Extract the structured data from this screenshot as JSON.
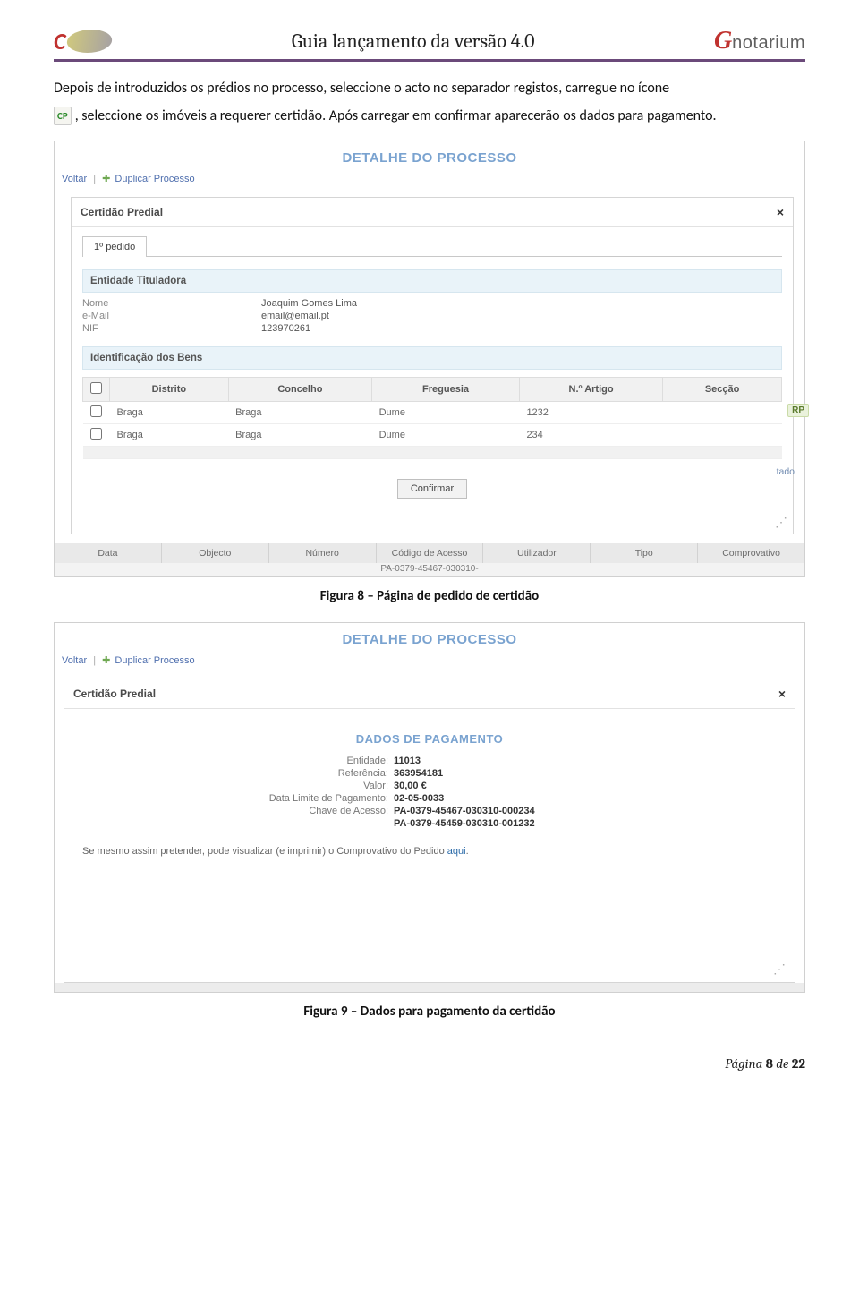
{
  "header": {
    "title": "Guia lançamento da versão 4.0",
    "brand_right_g": "G",
    "brand_right_rest": "notarium"
  },
  "paragraph": {
    "line1_a": "Depois de introduzidos os prédios no processo, seleccione o acto no separador registos, carregue no ícone",
    "cp_icon": "CP",
    "line2": ", seleccione os imóveis a requerer certidão. Após carregar em confirmar aparecerão os dados para pagamento."
  },
  "shot1": {
    "title": "DETALHE DO PROCESSO",
    "toolbar_back": "Voltar",
    "toolbar_dup": "Duplicar Processo",
    "panel_title": "Certidão Predial",
    "tab1": "1º pedido",
    "section1": "Entidade Tituladora",
    "fields": {
      "nome_l": "Nome",
      "nome_v": "Joaquim Gomes Lima",
      "email_l": "e-Mail",
      "email_v": "email@email.pt",
      "nif_l": "NIF",
      "nif_v": "123970261"
    },
    "section2": "Identificação dos Bens",
    "cols": {
      "c1": "Distrito",
      "c2": "Concelho",
      "c3": "Freguesia",
      "c4": "N.º Artigo",
      "c5": "Secção"
    },
    "rows": [
      {
        "distrito": "Braga",
        "concelho": "Braga",
        "freguesia": "Dume",
        "artigo": "1232",
        "seccao": ""
      },
      {
        "distrito": "Braga",
        "concelho": "Braga",
        "freguesia": "Dume",
        "artigo": "234",
        "seccao": ""
      }
    ],
    "btn_confirm": "Confirmar",
    "rp_badge": "RP",
    "bg_row": {
      "c1": "Data",
      "c2": "Objecto",
      "c3": "Número",
      "c4": "Código de Acesso",
      "c5": "Utilizador",
      "c6": "Tipo",
      "c7": "Comprovativo"
    },
    "bg_code": "PA-0379-45467-030310-",
    "side_text": "tado"
  },
  "caption1": "Figura 8 – Página de pedido de certidão",
  "shot2": {
    "title": "DETALHE DO PROCESSO",
    "toolbar_back": "Voltar",
    "toolbar_dup": "Duplicar Processo",
    "panel_title": "Certidão Predial",
    "pay_title": "DADOS DE PAGAMENTO",
    "pay": {
      "l1": "Entidade:",
      "v1": "11013",
      "l2": "Referência:",
      "v2": "363954181",
      "l3": "Valor:",
      "v3": "30,00 €",
      "l4": "Data Limite de Pagamento:",
      "v4": "02-05-0033",
      "l5": "Chave de Acesso:",
      "v5": "PA-0379-45467-030310-000234",
      "v6": "PA-0379-45459-030310-001232"
    },
    "print_note_a": "Se mesmo assim pretender, pode visualizar (e imprimir) o Comprovativo do Pedido ",
    "print_note_link": "aqui",
    "print_note_b": "."
  },
  "caption2": "Figura 9 – Dados para pagamento da certidão",
  "footer": {
    "prefix": "Página ",
    "current": "8",
    "of": " de ",
    "total": "22"
  }
}
